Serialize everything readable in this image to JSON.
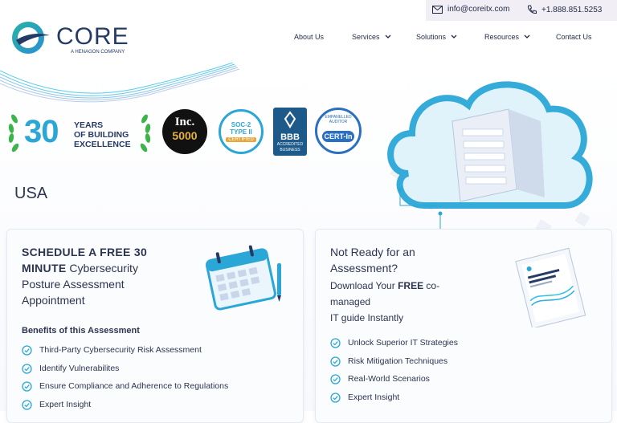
{
  "topbar": {
    "email": "info@coreitx.com",
    "phone": "+1.888.851.5253",
    "email_icon": "mail-icon",
    "phone_icon": "phone-icon"
  },
  "logo": {
    "word": "CORE",
    "subtitle": "A HENAGON COMPANY"
  },
  "nav": {
    "items": [
      {
        "label": "About Us",
        "dropdown": false
      },
      {
        "label": "Services",
        "dropdown": true
      },
      {
        "label": "Solutions",
        "dropdown": true
      },
      {
        "label": "Resources",
        "dropdown": true
      },
      {
        "label": "Contact Us",
        "dropdown": false
      }
    ]
  },
  "badges": {
    "years_number": "30",
    "years_text_1": "YEARS",
    "years_text_2": "OF BUILDING",
    "years_text_3": "EXCELLENCE",
    "inc_top": "Inc.",
    "inc_bottom": "5000",
    "soc_line1": "SOC-2",
    "soc_line2": "TYPE II",
    "soc_ribbon": "CERTIFIED",
    "bbb_main": "BBB",
    "bbb_sub1": "ACCREDITED",
    "bbb_sub2": "BUSINESS",
    "cert_main": "CERT-In",
    "cert_ring": "EMPANELLED AUDITOR"
  },
  "country": "USA",
  "left_card": {
    "title_bold_1": "SCHEDULE A FREE 30",
    "title_bold_2": "MINUTE",
    "title_rest_2": " Cybersecurity",
    "title_line_3": "Posture Assessment",
    "title_line_4": "Appointment",
    "benefits_heading": "Benefits of this Assessment",
    "benefits": [
      "Third-Party Cybersecurity Risk Assessment",
      "Identify Vulnerabilites",
      "Ensure Compliance and Adherence to Regulations",
      "Expert Insight"
    ]
  },
  "right_card": {
    "title_line_1": "Not Ready for an",
    "title_line_2": "Assessment?",
    "sub_line_1a": "Download Your ",
    "sub_line_1b": "FREE",
    "sub_line_1c": " co-",
    "sub_line_2": "managed",
    "sub_line_3": "IT guide Instantly",
    "points": [
      "Unlock Superior IT Strategies",
      "Risk Mitigation Techniques",
      "Real-World Scenarios",
      "Expert Insight"
    ]
  },
  "colors": {
    "accent": "#2aa7d6",
    "brand_dark": "#263a66",
    "topbar_bg": "#f1eef5",
    "laurel": "#3bb54a"
  }
}
